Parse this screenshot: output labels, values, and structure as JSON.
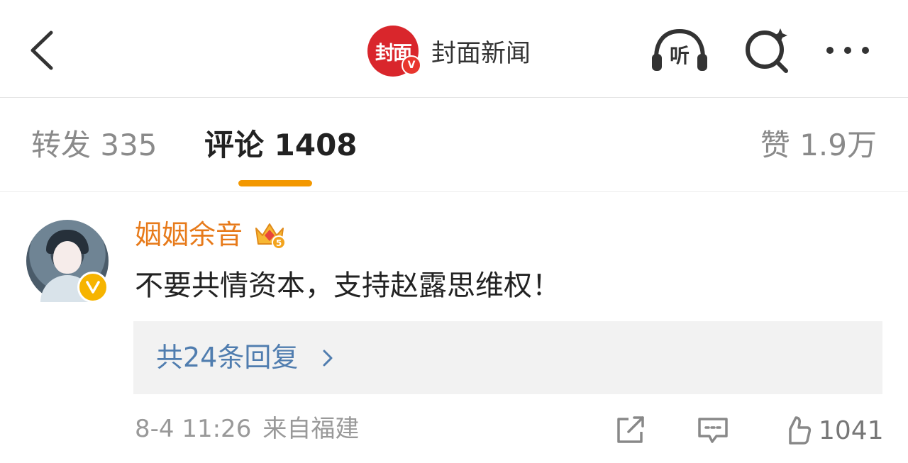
{
  "header": {
    "back_icon": "chevron-left-icon",
    "logo_text": "封面",
    "logo_badge": "V",
    "account_name": "封面新闻",
    "listen_label": "听",
    "search_icon": "search-sparkle-icon",
    "more_icon": "more-horizontal-icon"
  },
  "tabs": {
    "repost": "转发 335",
    "comment": "评论 1408",
    "like": "赞 1.9万",
    "active": "comment",
    "accent": "#f39800"
  },
  "comment": {
    "username": "姻姻余音",
    "username_color": "#e77a1a",
    "member_badge_icon": "vip-crown-icon",
    "member_level": "5",
    "text": "不要共情资本，支持赵露思维权！",
    "replies_label": "共24条回复",
    "replies_color": "#507daf",
    "date": "8-4 11:26",
    "location": "来自福建",
    "share_icon": "share-icon",
    "reply_icon": "comment-icon",
    "like_icon": "thumbs-up-icon",
    "like_count": "1041"
  }
}
